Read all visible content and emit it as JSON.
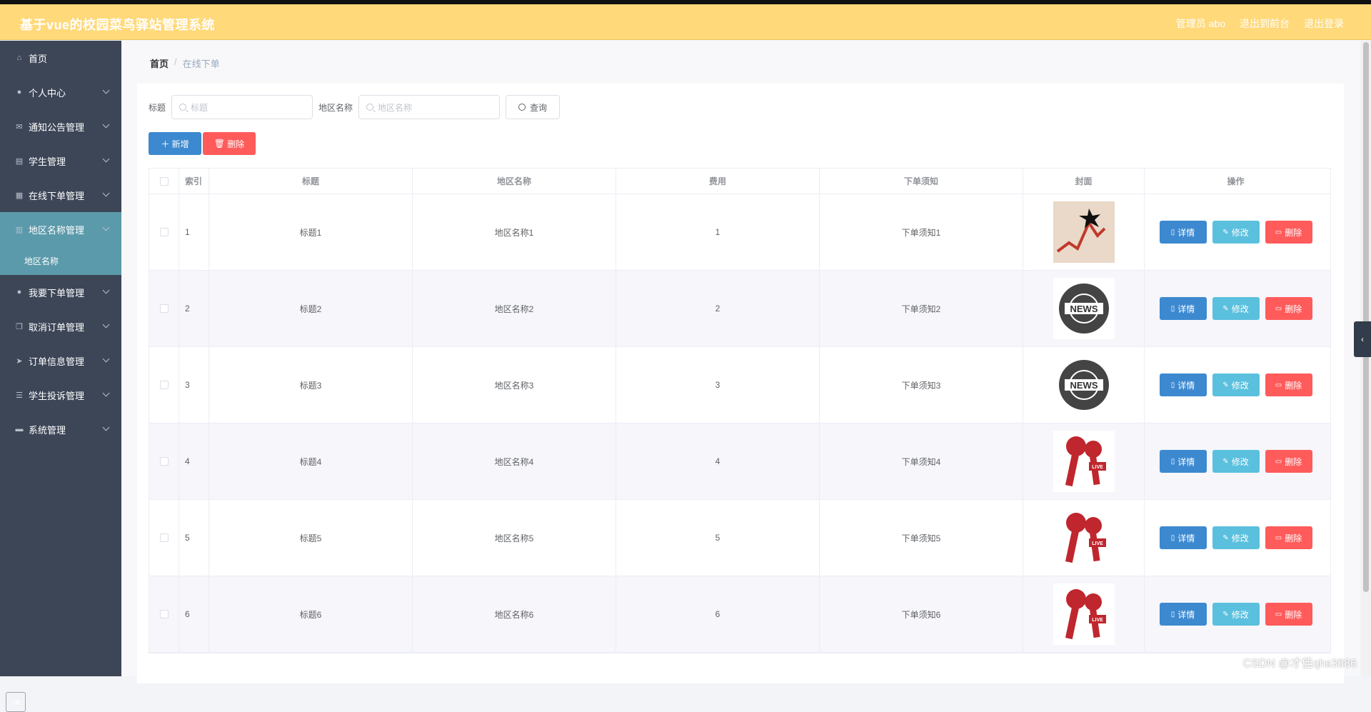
{
  "header": {
    "title": "基于vue的校园菜鸟驿站管理系统",
    "admin": "管理员 abo",
    "front": "退出到前台",
    "logout": "退出登录"
  },
  "sidebar": {
    "items": [
      {
        "label": "首页",
        "icon": "home-icon"
      },
      {
        "label": "个人中心",
        "icon": "user-icon"
      },
      {
        "label": "通知公告管理",
        "icon": "mail-icon"
      },
      {
        "label": "学生管理",
        "icon": "clipboard-icon"
      },
      {
        "label": "在线下单管理",
        "icon": "bank-icon"
      },
      {
        "label": "地区名称管理",
        "icon": "trash-icon"
      },
      {
        "label": "我要下单管理",
        "icon": "user-icon"
      },
      {
        "label": "取消订单管理",
        "icon": "copy-icon"
      },
      {
        "label": "订单信息管理",
        "icon": "send-icon"
      },
      {
        "label": "学生投诉管理",
        "icon": "list-icon"
      },
      {
        "label": "系统管理",
        "icon": "ticket-icon"
      }
    ],
    "active_sub": "地区名称"
  },
  "breadcrumb": {
    "home": "首页",
    "separator": "/",
    "current": "在线下单"
  },
  "search": {
    "title_label": "标题",
    "title_placeholder": "标题",
    "area_label": "地区名称",
    "area_placeholder": "地区名称",
    "query_button": "查询"
  },
  "toolbar": {
    "add_label": "新增",
    "delete_label": "删除"
  },
  "table": {
    "headers": {
      "index": "索引",
      "title": "标题",
      "area": "地区名称",
      "fee": "费用",
      "notice": "下单须知",
      "cover": "封面",
      "ops": "操作"
    },
    "ops": {
      "detail": "详情",
      "edit": "修改",
      "delete": "删除"
    },
    "rows": [
      {
        "index": "1",
        "title": "标题1",
        "area": "地区名称1",
        "fee": "1",
        "notice": "下单须知1",
        "cover": "chart"
      },
      {
        "index": "2",
        "title": "标题2",
        "area": "地区名称2",
        "fee": "2",
        "notice": "下单须知2",
        "cover": "news"
      },
      {
        "index": "3",
        "title": "标题3",
        "area": "地区名称3",
        "fee": "3",
        "notice": "下单须知3",
        "cover": "news"
      },
      {
        "index": "4",
        "title": "标题4",
        "area": "地区名称4",
        "fee": "4",
        "notice": "下单须知4",
        "cover": "mic"
      },
      {
        "index": "5",
        "title": "标题5",
        "area": "地区名称5",
        "fee": "5",
        "notice": "下单须知5",
        "cover": "mic"
      },
      {
        "index": "6",
        "title": "标题6",
        "area": "地区名称6",
        "fee": "6",
        "notice": "下单须知6",
        "cover": "mic"
      }
    ]
  },
  "watermark": "CSDN @才佳qhs3886",
  "colors": {
    "header": "#ffd97a",
    "sidebar": "#3d4657",
    "active": "#5b9aab",
    "primary": "#3c89d0",
    "danger": "#ff5b5b",
    "info": "#5bc0de"
  }
}
